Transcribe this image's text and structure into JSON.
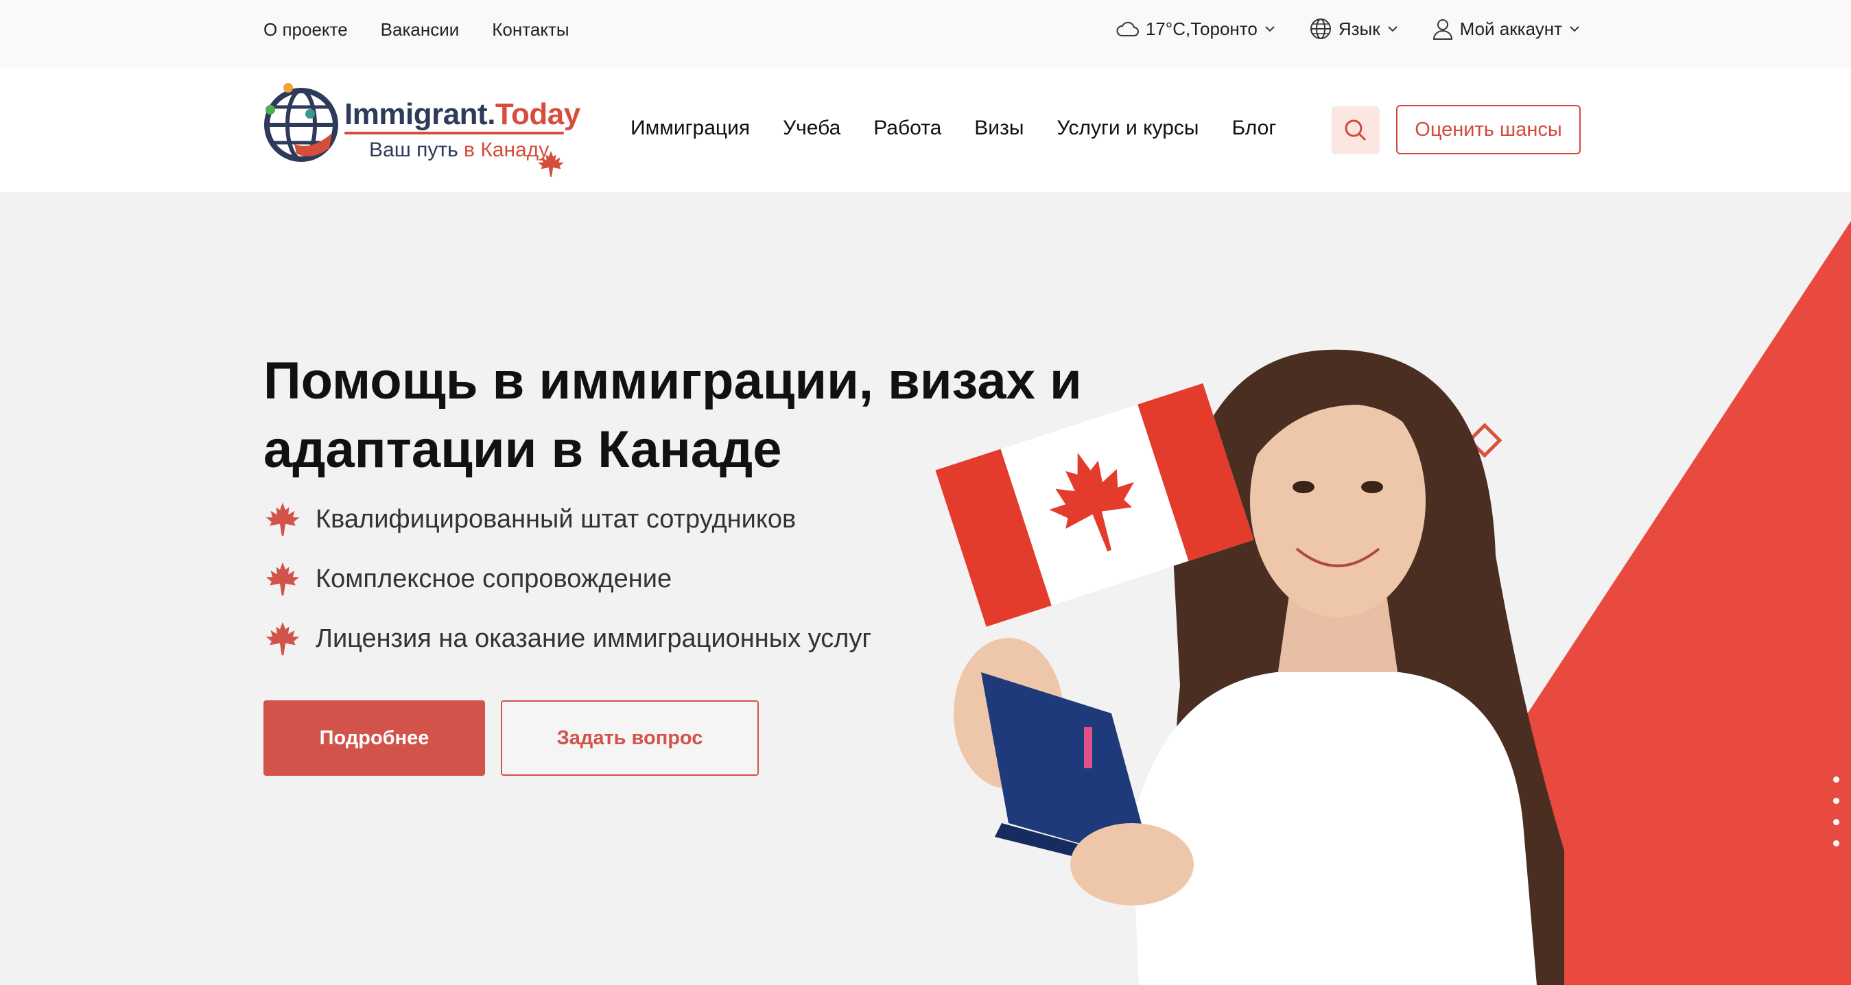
{
  "topbar": {
    "links": [
      "О проекте",
      "Вакансии",
      "Контакты"
    ],
    "weather": "17°C,Торонто",
    "language": "Язык",
    "account": "Мой аккаунт"
  },
  "header": {
    "logo": {
      "brand_main": "Immigrant.",
      "brand_accent": "Today",
      "tagline_main": "Ваш путь ",
      "tagline_accent": "в Канаду"
    },
    "nav": [
      "Иммиграция",
      "Учеба",
      "Работа",
      "Визы",
      "Услуги и курсы",
      "Блог"
    ],
    "search_icon": "search-icon",
    "cta": "Оценить шансы"
  },
  "hero": {
    "title": "Помощь в иммиграции, визах и адаптации в Канаде",
    "features": [
      "Квалифицированный штат сотрудников",
      "Комплексное сопровождение",
      "Лицензия на оказание иммиграционных услуг"
    ],
    "primary_button": "Подробнее",
    "secondary_button": "Задать вопрос",
    "slider_dots": 4
  },
  "colors": {
    "accent": "#d14a3b",
    "accent_light": "#fbe6e2",
    "hero_bg": "#f3f2f2",
    "dark_blue": "#2d3a5a"
  }
}
